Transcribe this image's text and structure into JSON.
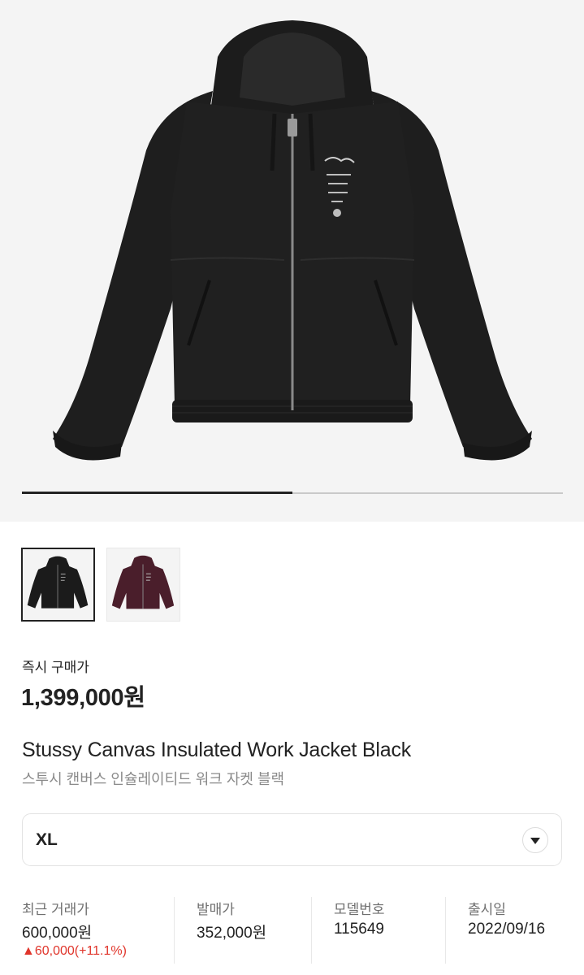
{
  "gallery": {
    "main_image": "Stussy black hooded canvas work jacket product photo",
    "carousel_progress": 0.5,
    "thumbnails": [
      {
        "color": "#1b1b1b",
        "selected": true
      },
      {
        "color": "#4a1e2b",
        "selected": false
      }
    ]
  },
  "price": {
    "label": "즉시 구매가",
    "value": "1,399,000원"
  },
  "product": {
    "name_en": "Stussy Canvas Insulated Work Jacket Black",
    "name_ko": "스투시 캔버스 인슐레이티드 워크 자켓 블랙"
  },
  "size_select": {
    "value": "XL",
    "icon": "chevron-down-icon"
  },
  "info": {
    "recent_trade": {
      "label": "최근 거래가",
      "value": "600,000원",
      "change": "▲60,000(+11.1%)"
    },
    "release_price": {
      "label": "발매가",
      "value": "352,000원"
    },
    "model_no": {
      "label": "모델번호",
      "value": "115649"
    },
    "release_date": {
      "label": "출시일",
      "value": "2022/09/16"
    }
  },
  "colors": {
    "accent_red": "#e0352b",
    "text": "#222222",
    "muted": "#8a8a8a",
    "hero_bg": "#f4f4f4"
  }
}
